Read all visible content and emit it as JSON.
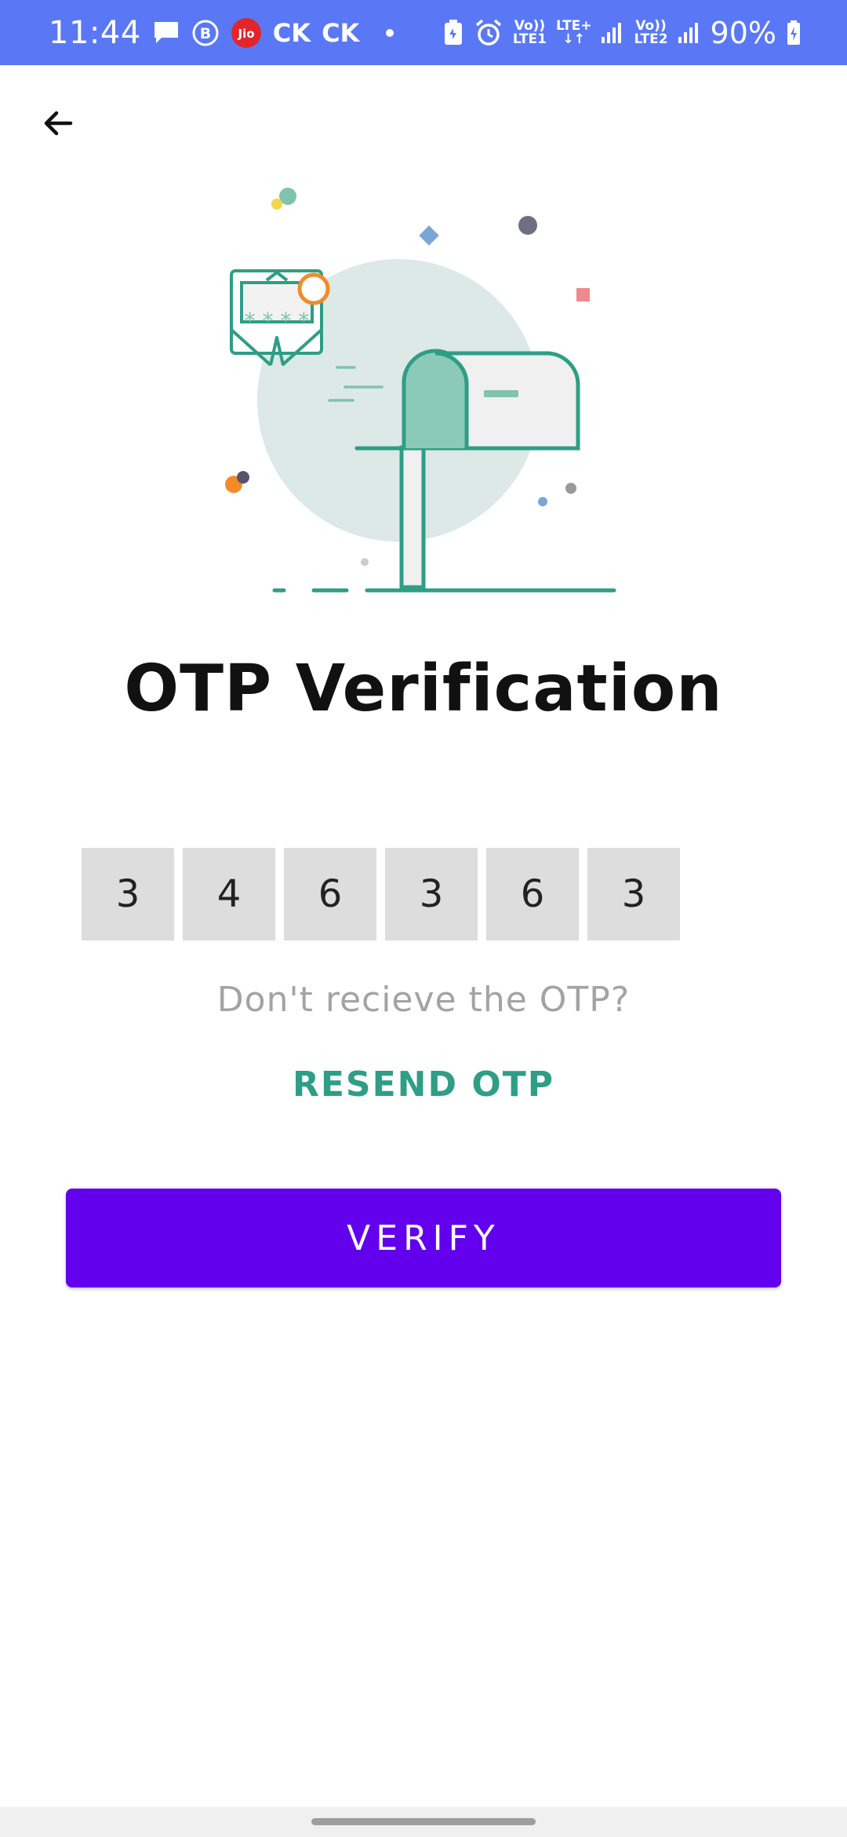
{
  "status_bar": {
    "time": "11:44",
    "carrier_badge": "Jio",
    "app_label_1": "CK",
    "app_label_2": "CK",
    "volte_1_top": "Vo))",
    "volte_1_bottom": "LTE1",
    "lte_plus": "LTE+",
    "volte_2_top": "Vo))",
    "volte_2_bottom": "LTE2",
    "battery": "90%",
    "icons": [
      "message-icon",
      "b-circle-icon",
      "jio-icon",
      "dot-icon",
      "battery-saver-icon",
      "alarm-icon",
      "signal-icon",
      "battery-charging-icon"
    ],
    "color": "#5a78f5"
  },
  "header": {
    "back_icon": "arrow-left-icon"
  },
  "main": {
    "title": "OTP Verification",
    "otp_digits": [
      "3",
      "4",
      "6",
      "3",
      "6",
      "3"
    ],
    "resend_prompt": "Don't recieve the OTP?",
    "resend_label": "RESEND OTP",
    "verify_label": "VERIFY",
    "illustration": "mailbox-envelope-illustration"
  },
  "colors": {
    "accent": "#6200ee",
    "resend": "#2e9e86",
    "otp_box": "#dddddd",
    "prompt_text": "#a3a3a3"
  }
}
